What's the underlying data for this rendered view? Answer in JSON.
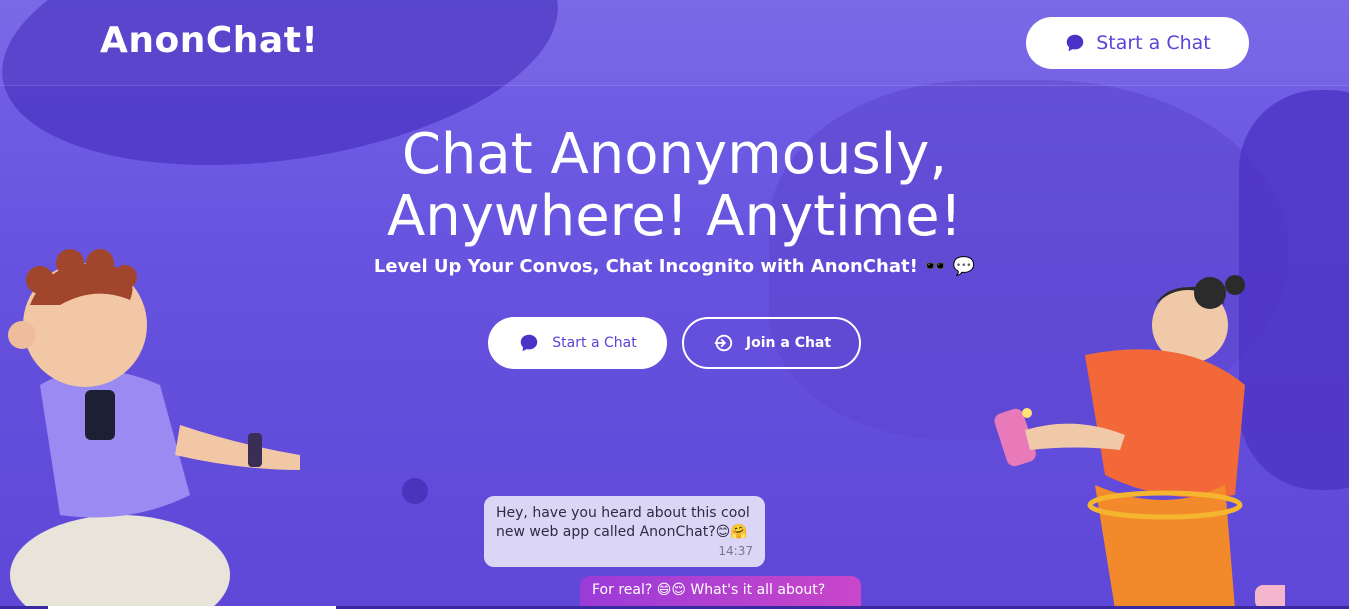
{
  "brand": {
    "logo": "AnonChat!"
  },
  "nav": {
    "cta_label": "Start a Chat"
  },
  "hero": {
    "title_line1": "Chat Anonymously,",
    "title_line2": "Anywhere! Anytime!",
    "subtitle": "Level Up Your Convos, Chat Incognito with AnonChat! 🕶️ 💬"
  },
  "actions": {
    "start_label": "Start a Chat",
    "join_label": "Join a Chat"
  },
  "chat_preview": {
    "message1": "Hey, have you heard about this cool new web app called AnonChat?😊🤗",
    "message1_time": "14:37",
    "message2": "For real? 😄😌 What's it all about?"
  },
  "colors": {
    "primary": "#6a52dc",
    "button_text": "#5b43d6",
    "bubble_in": "#dcd6f6"
  }
}
